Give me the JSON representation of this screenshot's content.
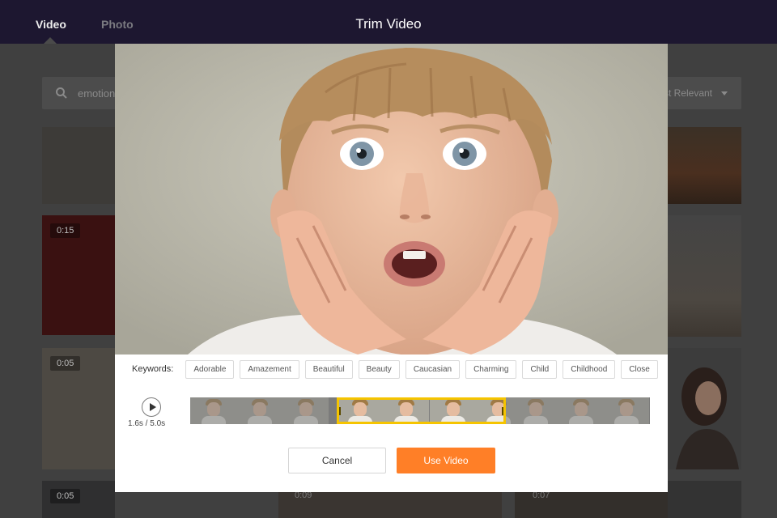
{
  "colors": {
    "accent": "#ff7f27",
    "selection": "#f5c400",
    "topbar": "#1d1730"
  },
  "background": {
    "tabs": [
      {
        "label": "Video",
        "active": true
      },
      {
        "label": "Photo",
        "active": false
      }
    ],
    "search": {
      "query": "emotion",
      "sort": "st Relevant"
    },
    "thumb_durations": [
      "0:15",
      "0:05",
      "0:05",
      "0:09",
      "0:07"
    ]
  },
  "modal": {
    "title": "Trim Video",
    "keywords_label": "Keywords:",
    "keywords": [
      "Adorable",
      "Amazement",
      "Beautiful",
      "Beauty",
      "Caucasian",
      "Charming",
      "Child",
      "Childhood",
      "Close"
    ],
    "time_display": "1.6s / 5.0s",
    "playback": {
      "current_s": 1.6,
      "duration_s": 5.0
    },
    "trim_selection": {
      "start_fraction": 0.32,
      "end_fraction": 0.69
    },
    "cancel_label": "Cancel",
    "use_label": "Use Video"
  }
}
